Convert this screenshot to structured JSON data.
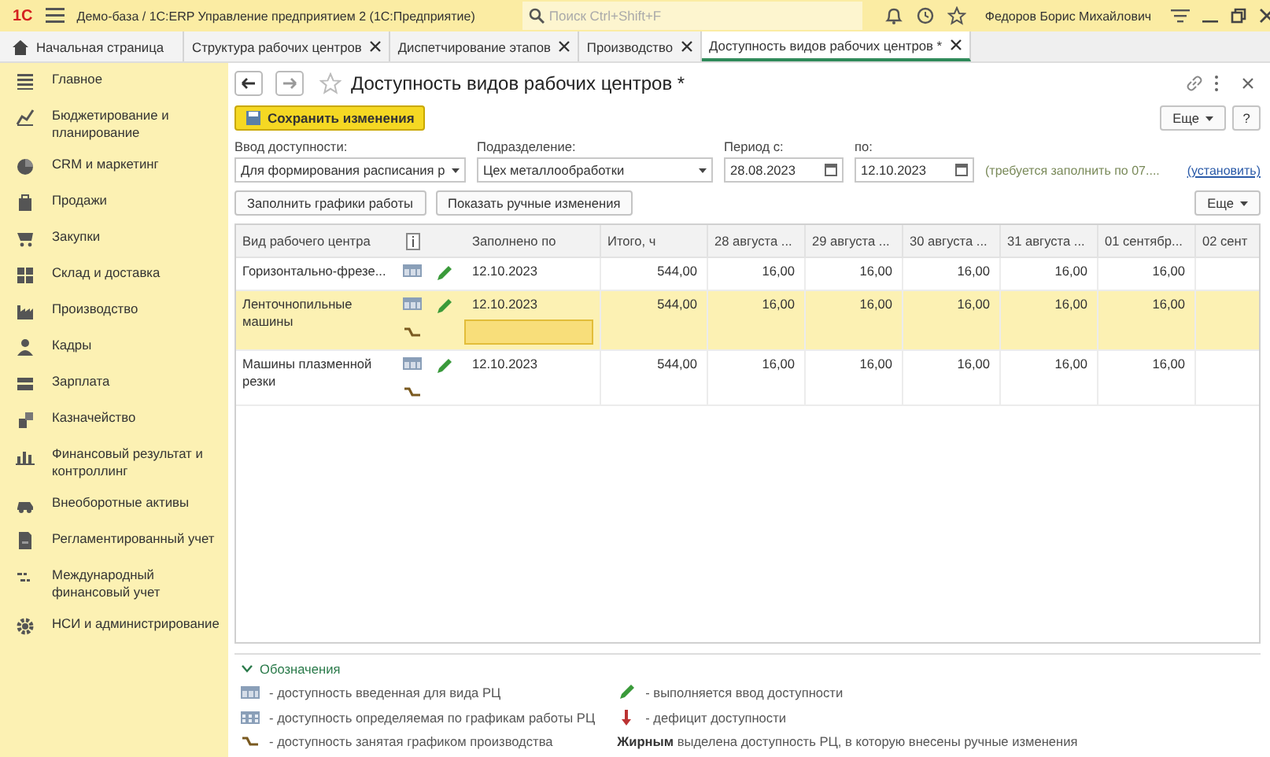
{
  "app": {
    "logo": "1С",
    "title": "Демо-база / 1С:ERP Управление предприятием 2  (1С:Предприятие)",
    "search": {
      "placeholder": "Поиск Ctrl+Shift+F"
    },
    "user": "Федоров Борис Михайлович"
  },
  "tabs": [
    {
      "label": "Начальная страница",
      "kind": "home",
      "selected": false
    },
    {
      "label": "Структура рабочих центров",
      "kind": "doc",
      "selected": false
    },
    {
      "label": "Диспетчирование этапов",
      "kind": "doc",
      "selected": false
    },
    {
      "label": "Производство",
      "kind": "doc",
      "selected": false
    },
    {
      "label": "Доступность видов рабочих центров *",
      "kind": "doc",
      "selected": true
    }
  ],
  "sidebar": {
    "items": [
      {
        "label": "Главное"
      },
      {
        "label": "Бюджетирование и планирование"
      },
      {
        "label": "CRM и маркетинг"
      },
      {
        "label": "Продажи"
      },
      {
        "label": "Закупки"
      },
      {
        "label": "Склад и доставка"
      },
      {
        "label": "Производство"
      },
      {
        "label": "Кадры"
      },
      {
        "label": "Зарплата"
      },
      {
        "label": "Казначейство"
      },
      {
        "label": "Финансовый результат и контроллинг"
      },
      {
        "label": "Внеоборотные активы"
      },
      {
        "label": "Регламентированный учет"
      },
      {
        "label": "Международный финансовый учет"
      },
      {
        "label": "НСИ и администрирование"
      }
    ]
  },
  "form": {
    "title": "Доступность видов рабочих центров *",
    "save_button": "Сохранить изменения",
    "more_button": "Еще",
    "help_button": "?",
    "fields": [
      {
        "label": "Ввод доступности:",
        "value": "Для формирования расписания р",
        "kind": "select"
      },
      {
        "label": "Подразделение:",
        "value": "Цех металлообработки",
        "kind": "select"
      },
      {
        "label": "Период с:",
        "value": "28.08.2023",
        "kind": "date"
      },
      {
        "label": "по:",
        "value": "12.10.2023",
        "kind": "date"
      }
    ],
    "hint": "(требуется заполнить по 07....",
    "hint_link": "(установить)",
    "actions": [
      "Заполнить графики работы",
      "Показать ручные изменения"
    ],
    "table_more_button": "Еще"
  },
  "table": {
    "columns": [
      "Вид рабочего центра",
      "",
      "Заполнено по",
      "Итого, ч",
      "28 августа ...",
      "29 августа ...",
      "30 августа ...",
      "31 августа ...",
      "01 сентябр...",
      "02 сент"
    ],
    "rows": [
      {
        "name": "Горизонтально-фрезе...",
        "selected": false,
        "in_progress": true,
        "occupied": false,
        "input_open": false,
        "filled_to": "12.10.2023",
        "total": "544,00",
        "days": [
          "16,00",
          "16,00",
          "16,00",
          "16,00",
          "16,00"
        ]
      },
      {
        "name": "Ленточнопильные машины",
        "selected": true,
        "in_progress": true,
        "occupied": true,
        "input_open": true,
        "filled_to": "12.10.2023",
        "total": "544,00",
        "days": [
          "16,00",
          "16,00",
          "16,00",
          "16,00",
          "16,00"
        ]
      },
      {
        "name": "Машины плазменной резки",
        "selected": false,
        "in_progress": true,
        "occupied": true,
        "input_open": false,
        "filled_to": "12.10.2023",
        "total": "544,00",
        "days": [
          "16,00",
          "16,00",
          "16,00",
          "16,00",
          "16,00"
        ]
      }
    ]
  },
  "legend": {
    "title": "Обозначения",
    "expanded": true,
    "items": [
      {
        "kind": "entered",
        "text": "- доступность введенная для вида РЦ"
      },
      {
        "kind": "pencil",
        "text": "- выполняется ввод доступности"
      },
      {
        "kind": "schedule",
        "text": "- доступность определяемая по графикам работы РЦ"
      },
      {
        "kind": "deficit",
        "text": "- дефицит доступности"
      },
      {
        "kind": "occupied",
        "text": "- доступность занятая графиком производства"
      },
      {
        "kind": "note",
        "text": "**Жирным** выделена доступность РЦ, в которую внесены ручные изменения"
      }
    ]
  }
}
